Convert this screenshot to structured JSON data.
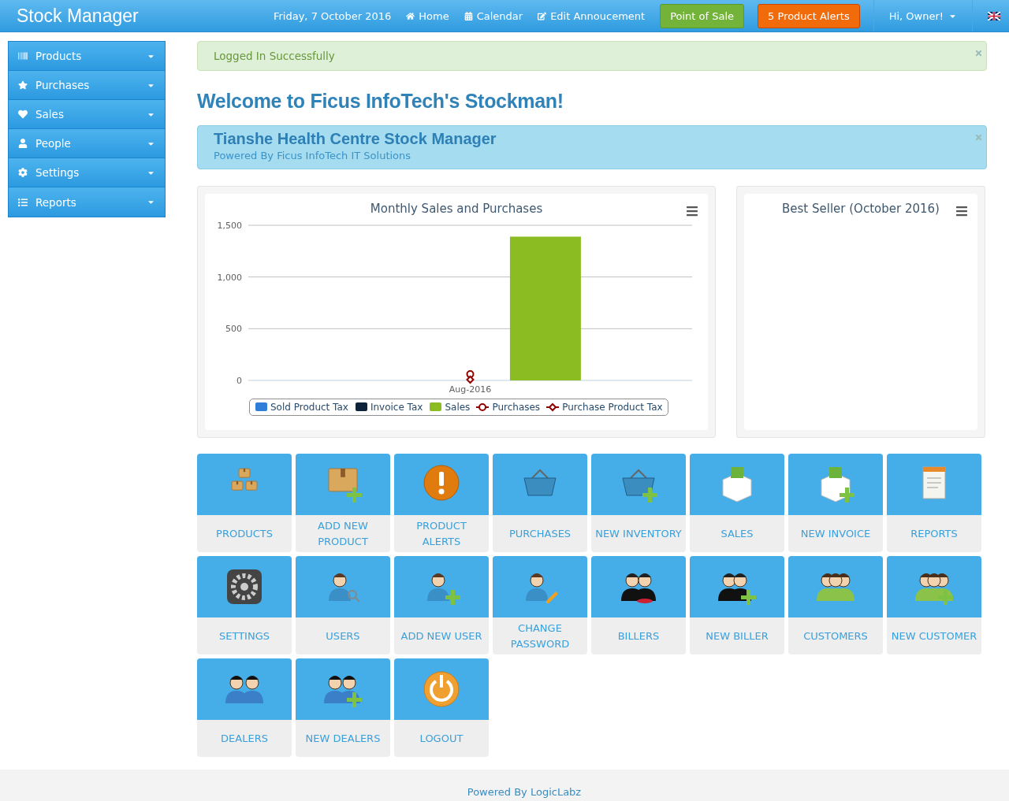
{
  "navbar": {
    "brand": "Stock Manager",
    "date": "Friday, 7 October 2016",
    "links": [
      {
        "label": "Home"
      },
      {
        "label": "Calendar"
      },
      {
        "label": "Edit Annoucement"
      }
    ],
    "buttons": [
      {
        "label": "Point of Sale",
        "kind": "success"
      },
      {
        "label": "5 Product Alerts",
        "kind": "warning"
      }
    ],
    "user": "Hi, Owner!"
  },
  "sidebar": {
    "items": [
      {
        "label": "Products"
      },
      {
        "label": "Purchases"
      },
      {
        "label": "Sales"
      },
      {
        "label": "People"
      },
      {
        "label": "Settings"
      },
      {
        "label": "Reports"
      }
    ]
  },
  "alert": {
    "text": "Logged In Successfully"
  },
  "heading": "Welcome to Ficus InfoTech's Stockman!",
  "info": {
    "title": "Tianshe Health Centre Stock Manager",
    "subtitle": "Powered By Ficus InfoTech IT Solutions"
  },
  "sales_chart": {
    "chart_data": {
      "type": "bar",
      "title": "Monthly Sales and Purchases",
      "categories": [
        "Aug-2016"
      ],
      "ylim": [
        0,
        1500
      ],
      "yticks": [
        0,
        500,
        {
          "value": 1000,
          "label": "1,000"
        },
        {
          "value": 1500,
          "label": "1,500"
        }
      ],
      "series": [
        {
          "name": "Sold Product Tax",
          "color": "#2f7ed8",
          "values": [
            null
          ]
        },
        {
          "name": "Invoice Tax",
          "color": "#0d233a",
          "values": [
            null
          ]
        },
        {
          "name": "Sales",
          "color": "#8bbc21",
          "values": [
            1390
          ]
        }
      ]
    },
    "line_legend": [
      {
        "name": "Purchases",
        "color": "#910000"
      },
      {
        "name": "Purchase Product Tax",
        "color": "#910000"
      }
    ]
  },
  "best_seller": {
    "title": "Best Seller (October 2016)"
  },
  "tiles": [
    {
      "label": "PRODUCTS"
    },
    {
      "label": "ADD NEW PRODUCT"
    },
    {
      "label": "PRODUCT ALERTS"
    },
    {
      "label": "PURCHASES"
    },
    {
      "label": "NEW INVENTORY"
    },
    {
      "label": "SALES"
    },
    {
      "label": "NEW INVOICE"
    },
    {
      "label": "REPORTS"
    },
    {
      "label": "SETTINGS"
    },
    {
      "label": "USERS"
    },
    {
      "label": "ADD NEW USER"
    },
    {
      "label": "CHANGE PASSWORD"
    },
    {
      "label": "BILLERS"
    },
    {
      "label": "NEW BILLER"
    },
    {
      "label": "CUSTOMERS"
    },
    {
      "label": "NEW CUSTOMER"
    },
    {
      "label": "DEALERS"
    },
    {
      "label": "NEW DEALERS"
    },
    {
      "label": "LOGOUT"
    }
  ],
  "footer": {
    "text": "Powered By LogicLabz"
  }
}
